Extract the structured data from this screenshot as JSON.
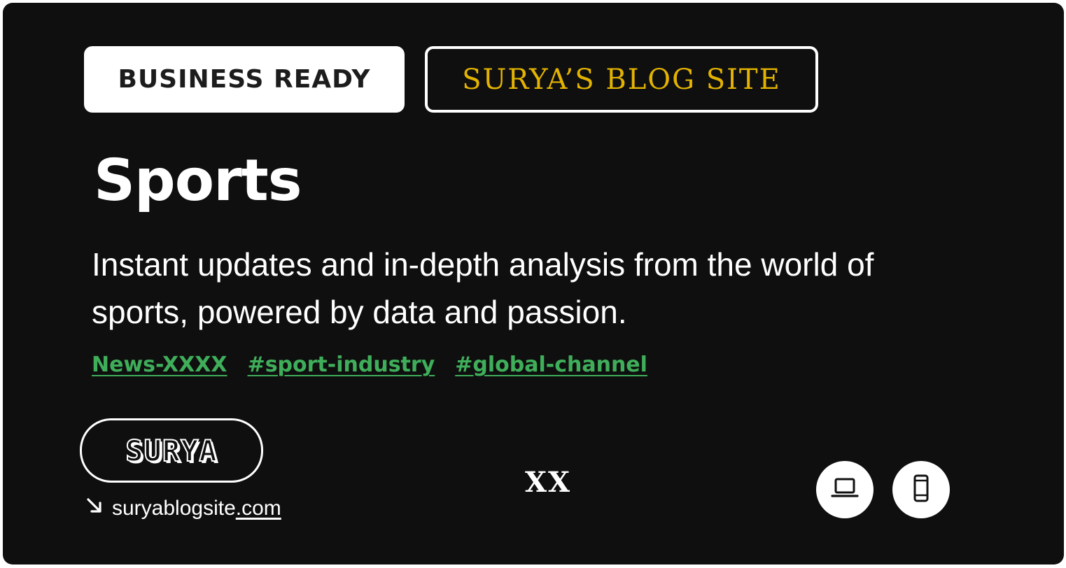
{
  "card": {
    "badge_primary": "BUSINESS READY",
    "badge_secondary": "SURYA’S BLOG SITE",
    "title": "Sports",
    "description": "Instant updates and in-depth analysis from the world of sports, powered by data and passion.",
    "tags": [
      "News-XXXX",
      "#sport-industry",
      "#global-channel"
    ],
    "logo_text": "SURYA",
    "site_link": {
      "icon": "arrow-down-right-icon",
      "domain": "suryablogsite",
      "tld": ".com"
    },
    "center_mark": "XX",
    "device_buttons": [
      {
        "icon": "laptop-icon"
      },
      {
        "icon": "smartphone-icon"
      }
    ]
  },
  "colors": {
    "background": "#0f0f0f",
    "accent_gold": "#e3b300",
    "tag_green": "#3fae5a",
    "text": "#ffffff"
  }
}
